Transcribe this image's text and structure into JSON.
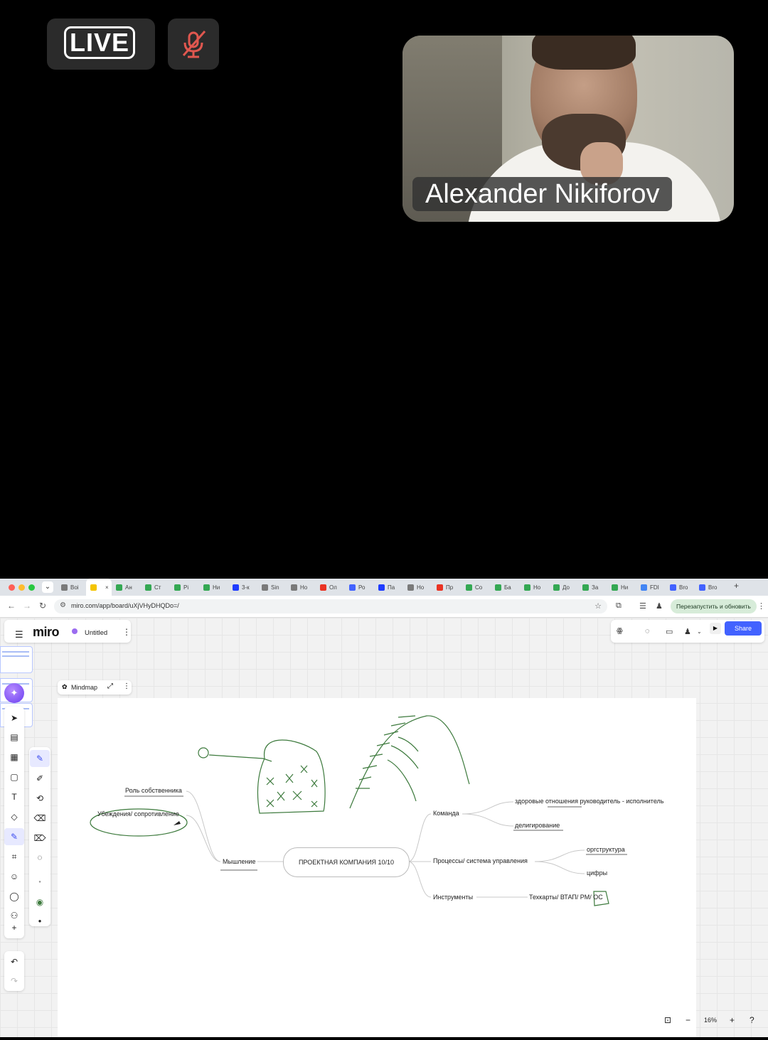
{
  "stream": {
    "live_label": "LIVE",
    "mic_icon": "mic-muted-icon",
    "participant_name": "Alexander Nikiforov"
  },
  "browser": {
    "tabs": [
      {
        "label": "Boi",
        "color": "#7a7a7a"
      },
      {
        "label": "",
        "color": "#f4c400",
        "active": true
      },
      {
        "label": "Aн",
        "color": "#34a853"
      },
      {
        "label": "Ст",
        "color": "#34a853"
      },
      {
        "label": "Рі",
        "color": "#34a853"
      },
      {
        "label": "Ни",
        "color": "#34a853"
      },
      {
        "label": "3-к",
        "color": "#1f3cff"
      },
      {
        "label": "Sin",
        "color": "#7a7a7a"
      },
      {
        "label": "Но",
        "color": "#7a7a7a"
      },
      {
        "label": "Ол",
        "color": "#ea3323"
      },
      {
        "label": "Ро",
        "color": "#4262ff"
      },
      {
        "label": "Па",
        "color": "#1f3cff"
      },
      {
        "label": "Но",
        "color": "#7a7a7a"
      },
      {
        "label": "Пр",
        "color": "#ea3323"
      },
      {
        "label": "Со",
        "color": "#34a853"
      },
      {
        "label": "Ба",
        "color": "#34a853"
      },
      {
        "label": "Но",
        "color": "#34a853"
      },
      {
        "label": "До",
        "color": "#34a853"
      },
      {
        "label": "За",
        "color": "#34a853"
      },
      {
        "label": "Ни",
        "color": "#34a853"
      },
      {
        "label": "FDI",
        "color": "#4285f4"
      },
      {
        "label": "Bro",
        "color": "#4262ff"
      },
      {
        "label": "Bro",
        "color": "#4262ff"
      }
    ],
    "url": "miro.com/app/board/uXjVHyDHQDo=/",
    "restart_label": "Перезапустить и обновить"
  },
  "miro": {
    "logo": "miro",
    "board_title": "Untitled",
    "share_label": "Share",
    "mindmap_label": "Mindmap",
    "zoom": "16%",
    "mindmap": {
      "root": "ПРОЕКТНАЯ КОМПАНИЯ 10/10",
      "left": {
        "main": "Мышление",
        "children": [
          "Роль собственника",
          "Убеждения/ сопротивление"
        ]
      },
      "right": [
        {
          "label": "Команда",
          "children": [
            "здоровые отношения руководитель - исполнитель",
            "делигирование"
          ]
        },
        {
          "label": "Процессы/ система управления",
          "children": [
            "оргструктура",
            "цифры"
          ]
        },
        {
          "label": "Инструменты",
          "children": [
            "Техкарты/ ВТАП/ РМ/ ОС"
          ]
        }
      ]
    }
  }
}
